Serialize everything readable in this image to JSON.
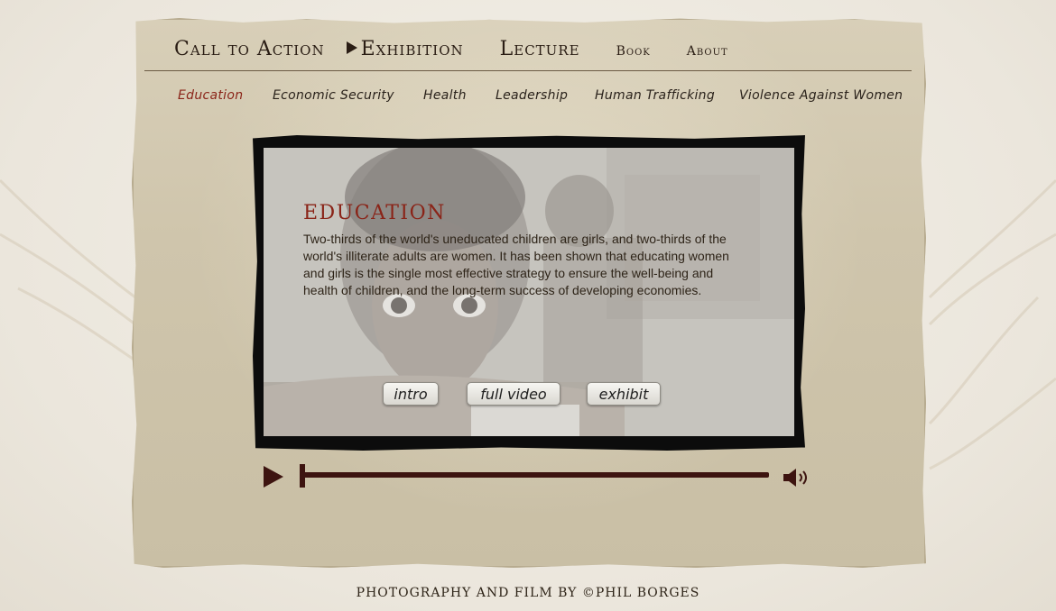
{
  "top_nav": {
    "items": [
      {
        "label": "Call to Action",
        "size": "big",
        "active": false
      },
      {
        "label": "Exhibition",
        "size": "big",
        "active": true
      },
      {
        "label": "Lecture",
        "size": "big",
        "active": false
      },
      {
        "label": "Book",
        "size": "small",
        "active": false
      },
      {
        "label": "About",
        "size": "small",
        "active": false
      }
    ]
  },
  "sub_nav": {
    "items": [
      {
        "label": "Education",
        "active": true
      },
      {
        "label": "Economic Security",
        "active": false
      },
      {
        "label": "Health",
        "active": false
      },
      {
        "label": "Leadership",
        "active": false
      },
      {
        "label": "Human Trafficking",
        "active": false
      },
      {
        "label": "Violence Against Women",
        "active": false
      }
    ]
  },
  "video": {
    "title": "EDUCATION",
    "text": "Two-thirds of the world's uneducated children are girls, and two-thirds of the world's illiterate adults are women. It has been shown that educating women and girls is the single most effective strategy to ensure the well-being and health of children, and the long-term success of developing economies.",
    "buttons": {
      "intro": "intro",
      "full_video": "full video",
      "exhibit": "exhibit"
    }
  },
  "player": {
    "progress": 0.0
  },
  "colors": {
    "accent": "#8a2418",
    "ink": "#2a1d14",
    "player": "#3d1410"
  },
  "footer": {
    "credit": "PHOTOGRAPHY AND FILM BY ©PHIL BORGES"
  }
}
